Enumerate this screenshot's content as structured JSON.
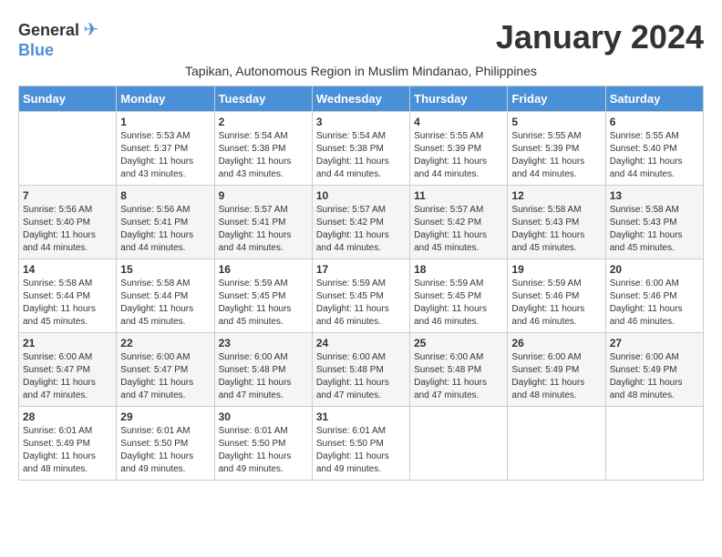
{
  "header": {
    "logo_general": "General",
    "logo_blue": "Blue",
    "month_title": "January 2024",
    "subtitle": "Tapikan, Autonomous Region in Muslim Mindanao, Philippines"
  },
  "days_of_week": [
    "Sunday",
    "Monday",
    "Tuesday",
    "Wednesday",
    "Thursday",
    "Friday",
    "Saturday"
  ],
  "weeks": [
    [
      {
        "day": "",
        "info": ""
      },
      {
        "day": "1",
        "info": "Sunrise: 5:53 AM\nSunset: 5:37 PM\nDaylight: 11 hours\nand 43 minutes."
      },
      {
        "day": "2",
        "info": "Sunrise: 5:54 AM\nSunset: 5:38 PM\nDaylight: 11 hours\nand 43 minutes."
      },
      {
        "day": "3",
        "info": "Sunrise: 5:54 AM\nSunset: 5:38 PM\nDaylight: 11 hours\nand 44 minutes."
      },
      {
        "day": "4",
        "info": "Sunrise: 5:55 AM\nSunset: 5:39 PM\nDaylight: 11 hours\nand 44 minutes."
      },
      {
        "day": "5",
        "info": "Sunrise: 5:55 AM\nSunset: 5:39 PM\nDaylight: 11 hours\nand 44 minutes."
      },
      {
        "day": "6",
        "info": "Sunrise: 5:55 AM\nSunset: 5:40 PM\nDaylight: 11 hours\nand 44 minutes."
      }
    ],
    [
      {
        "day": "7",
        "info": "Sunrise: 5:56 AM\nSunset: 5:40 PM\nDaylight: 11 hours\nand 44 minutes."
      },
      {
        "day": "8",
        "info": "Sunrise: 5:56 AM\nSunset: 5:41 PM\nDaylight: 11 hours\nand 44 minutes."
      },
      {
        "day": "9",
        "info": "Sunrise: 5:57 AM\nSunset: 5:41 PM\nDaylight: 11 hours\nand 44 minutes."
      },
      {
        "day": "10",
        "info": "Sunrise: 5:57 AM\nSunset: 5:42 PM\nDaylight: 11 hours\nand 44 minutes."
      },
      {
        "day": "11",
        "info": "Sunrise: 5:57 AM\nSunset: 5:42 PM\nDaylight: 11 hours\nand 45 minutes."
      },
      {
        "day": "12",
        "info": "Sunrise: 5:58 AM\nSunset: 5:43 PM\nDaylight: 11 hours\nand 45 minutes."
      },
      {
        "day": "13",
        "info": "Sunrise: 5:58 AM\nSunset: 5:43 PM\nDaylight: 11 hours\nand 45 minutes."
      }
    ],
    [
      {
        "day": "14",
        "info": "Sunrise: 5:58 AM\nSunset: 5:44 PM\nDaylight: 11 hours\nand 45 minutes."
      },
      {
        "day": "15",
        "info": "Sunrise: 5:58 AM\nSunset: 5:44 PM\nDaylight: 11 hours\nand 45 minutes."
      },
      {
        "day": "16",
        "info": "Sunrise: 5:59 AM\nSunset: 5:45 PM\nDaylight: 11 hours\nand 45 minutes."
      },
      {
        "day": "17",
        "info": "Sunrise: 5:59 AM\nSunset: 5:45 PM\nDaylight: 11 hours\nand 46 minutes."
      },
      {
        "day": "18",
        "info": "Sunrise: 5:59 AM\nSunset: 5:45 PM\nDaylight: 11 hours\nand 46 minutes."
      },
      {
        "day": "19",
        "info": "Sunrise: 5:59 AM\nSunset: 5:46 PM\nDaylight: 11 hours\nand 46 minutes."
      },
      {
        "day": "20",
        "info": "Sunrise: 6:00 AM\nSunset: 5:46 PM\nDaylight: 11 hours\nand 46 minutes."
      }
    ],
    [
      {
        "day": "21",
        "info": "Sunrise: 6:00 AM\nSunset: 5:47 PM\nDaylight: 11 hours\nand 47 minutes."
      },
      {
        "day": "22",
        "info": "Sunrise: 6:00 AM\nSunset: 5:47 PM\nDaylight: 11 hours\nand 47 minutes."
      },
      {
        "day": "23",
        "info": "Sunrise: 6:00 AM\nSunset: 5:48 PM\nDaylight: 11 hours\nand 47 minutes."
      },
      {
        "day": "24",
        "info": "Sunrise: 6:00 AM\nSunset: 5:48 PM\nDaylight: 11 hours\nand 47 minutes."
      },
      {
        "day": "25",
        "info": "Sunrise: 6:00 AM\nSunset: 5:48 PM\nDaylight: 11 hours\nand 47 minutes."
      },
      {
        "day": "26",
        "info": "Sunrise: 6:00 AM\nSunset: 5:49 PM\nDaylight: 11 hours\nand 48 minutes."
      },
      {
        "day": "27",
        "info": "Sunrise: 6:00 AM\nSunset: 5:49 PM\nDaylight: 11 hours\nand 48 minutes."
      }
    ],
    [
      {
        "day": "28",
        "info": "Sunrise: 6:01 AM\nSunset: 5:49 PM\nDaylight: 11 hours\nand 48 minutes."
      },
      {
        "day": "29",
        "info": "Sunrise: 6:01 AM\nSunset: 5:50 PM\nDaylight: 11 hours\nand 49 minutes."
      },
      {
        "day": "30",
        "info": "Sunrise: 6:01 AM\nSunset: 5:50 PM\nDaylight: 11 hours\nand 49 minutes."
      },
      {
        "day": "31",
        "info": "Sunrise: 6:01 AM\nSunset: 5:50 PM\nDaylight: 11 hours\nand 49 minutes."
      },
      {
        "day": "",
        "info": ""
      },
      {
        "day": "",
        "info": ""
      },
      {
        "day": "",
        "info": ""
      }
    ]
  ]
}
